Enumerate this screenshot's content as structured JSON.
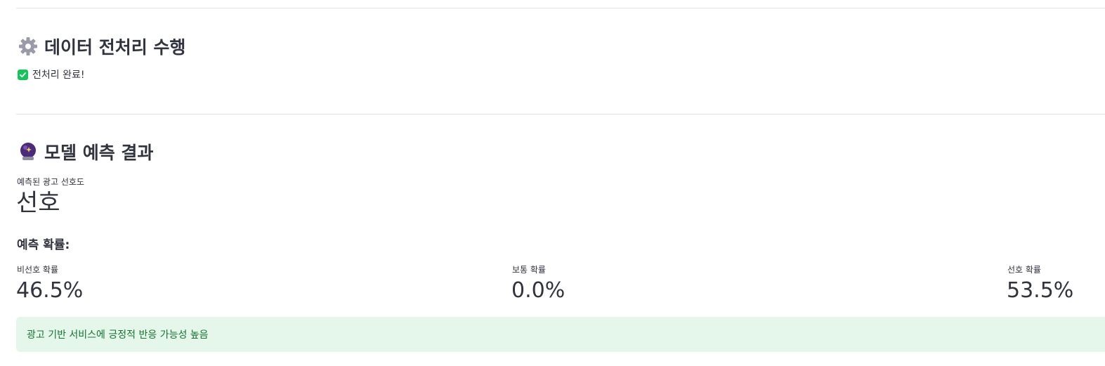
{
  "preprocess": {
    "title": "데이터 전처리 수행",
    "icon": "gear-icon",
    "status_text": "전처리 완료!",
    "status_icon": "check-mark-button-icon"
  },
  "result": {
    "title": "모델 예측 결과",
    "icon": "crystal-ball-icon",
    "prediction_label": "예측된 광고 선호도",
    "prediction_value": "선호",
    "probability_heading": "예측 확률:",
    "probabilities": [
      {
        "label": "비선호 확률",
        "value": "46.5%"
      },
      {
        "label": "보통 확률",
        "value": "0.0%"
      },
      {
        "label": "선호 확률",
        "value": "53.5%"
      }
    ],
    "success_message": "광고 기반 서비스에 긍정적 반응 가능성 높음"
  },
  "colors": {
    "success_bg": "#e4f7ea",
    "success_text": "#177233",
    "check_green": "#18c35b",
    "text": "#31333f"
  }
}
